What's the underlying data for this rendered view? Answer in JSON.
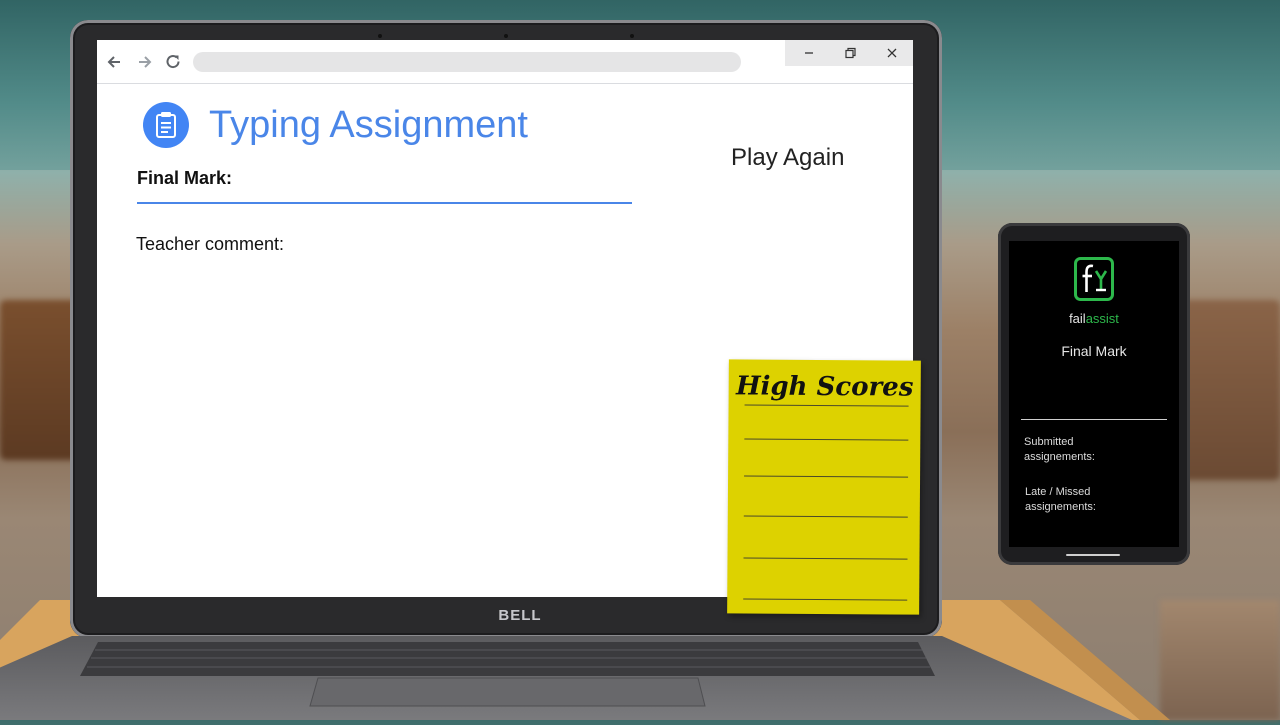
{
  "browser": {
    "back_icon": "arrow-left-icon",
    "forward_icon": "arrow-right-icon",
    "reload_icon": "reload-icon",
    "url": "",
    "window_controls": [
      "minimize-icon",
      "restore-icon",
      "close-icon"
    ]
  },
  "app": {
    "icon": "clipboard-icon",
    "icon_color": "#4285f4",
    "title": "Typing Assignment",
    "final_mark_label": "Final Mark:",
    "teacher_comment_label": "Teacher comment:",
    "play_again_label": "Play Again"
  },
  "laptop": {
    "brand": "BELL"
  },
  "sticky_note": {
    "title": "High Scores",
    "color": "#ddd200",
    "entries": []
  },
  "phone": {
    "app_name_part1": "fail",
    "app_name_part2": "assist",
    "brand_color": "#2db84b",
    "final_mark_label": "Final Mark",
    "submitted_label": "Submitted assignements:",
    "late_label": "Late / Missed assignements:"
  }
}
